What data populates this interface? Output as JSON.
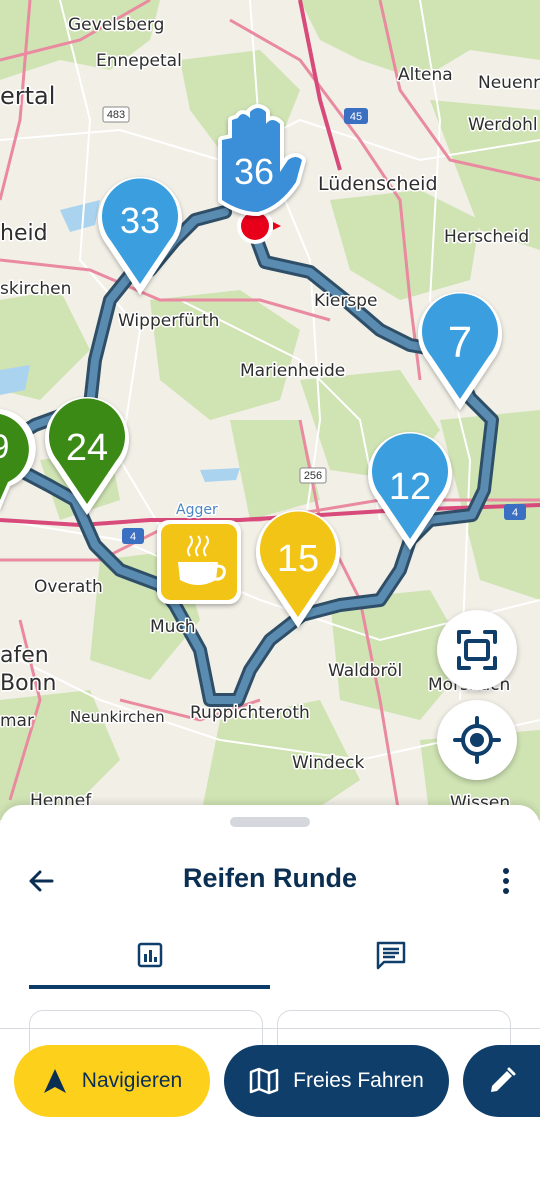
{
  "map": {
    "places": [
      {
        "name": "Gevelsberg"
      },
      {
        "name": "Ennepetal"
      },
      {
        "name": "Altena"
      },
      {
        "name": "Neuenra"
      },
      {
        "name": "Werdohl"
      },
      {
        "name": "Lüdenscheid"
      },
      {
        "name": "Herscheid"
      },
      {
        "name": "Kierspe"
      },
      {
        "name": "Wipperfürth"
      },
      {
        "name": "Marienheide"
      },
      {
        "name": "Overath"
      },
      {
        "name": "Much"
      },
      {
        "name": "Waldbröl"
      },
      {
        "name": "Morsbach"
      },
      {
        "name": "Ruppichteroth"
      },
      {
        "name": "Neunkirchen"
      },
      {
        "name": "Windeck"
      },
      {
        "name": "Hennef"
      },
      {
        "name": "Wissen"
      },
      {
        "name": "ertal"
      },
      {
        "name": "heid"
      },
      {
        "name": "skirchen"
      },
      {
        "name": "afen"
      },
      {
        "name": "Bonn"
      },
      {
        "name": "mar"
      },
      {
        "name": "Agger"
      }
    ],
    "road_shields": [
      "483",
      "45",
      "256",
      "4",
      "4"
    ],
    "markers": [
      {
        "label": "33",
        "color": "#3a9fdf"
      },
      {
        "label": "7",
        "color": "#3a9fdf"
      },
      {
        "label": "12",
        "color": "#3a9fdf"
      },
      {
        "label": "24",
        "color": "#3a8a12"
      },
      {
        "label": "15",
        "color": "#f2c417"
      },
      {
        "label": "36",
        "color": "#3a8fd8"
      }
    ],
    "route_color": "#4d7390"
  },
  "sheet": {
    "title": "Reifen Runde",
    "tabs": [
      {
        "icon": "stats-chart-icon",
        "active": true
      },
      {
        "icon": "message-icon",
        "active": false
      }
    ]
  },
  "actions": {
    "navigate_label": "Navigieren",
    "free_ride_label": "Freies Fahren"
  },
  "colors": {
    "accent_yellow": "#fdd01b",
    "primary_navy": "#0f3e6a"
  }
}
